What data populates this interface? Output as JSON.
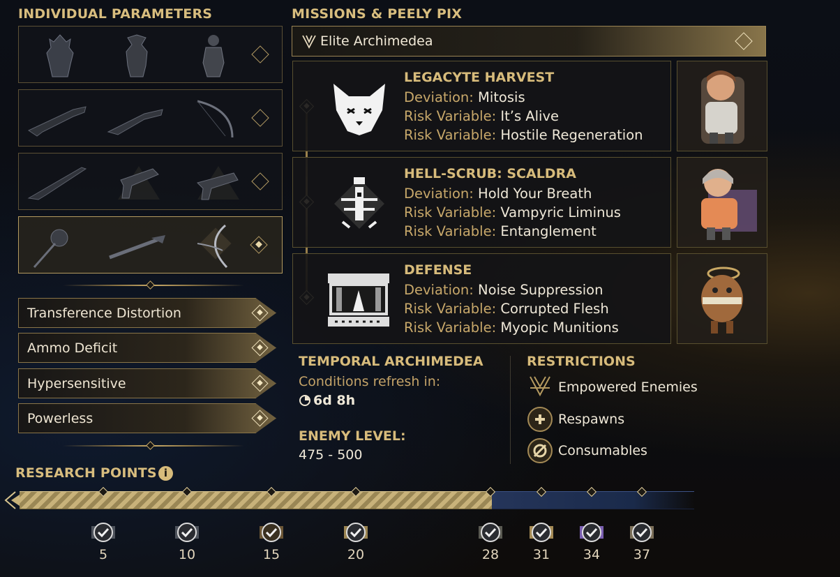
{
  "left": {
    "title": "INDIVIDUAL PARAMETERS",
    "modifiers": [
      "Transference Distortion",
      "Ammo Deficit",
      "Hypersensitive",
      "Powerless"
    ]
  },
  "missions": {
    "title": "MISSIONS & PEELY PIX",
    "header": "Elite Archimedea",
    "cards": [
      {
        "title": "LEGACYTE HARVEST",
        "lines": [
          {
            "key": "Deviation:",
            "value": "Mitosis"
          },
          {
            "key": "Risk Variable:",
            "value": "It’s Alive"
          },
          {
            "key": "Risk Variable:",
            "value": "Hostile Regeneration"
          }
        ]
      },
      {
        "title": "HELL-SCRUB: SCALDRA",
        "lines": [
          {
            "key": "Deviation:",
            "value": "Hold Your Breath"
          },
          {
            "key": "Risk Variable:",
            "value": "Vampyric Liminus"
          },
          {
            "key": "Risk Variable:",
            "value": "Entanglement"
          }
        ]
      },
      {
        "title": "DEFENSE",
        "lines": [
          {
            "key": "Deviation:",
            "value": "Noise Suppression"
          },
          {
            "key": "Risk Variable:",
            "value": "Corrupted Flesh"
          },
          {
            "key": "Risk Variable:",
            "value": "Myopic Munitions"
          }
        ]
      }
    ]
  },
  "temporal": {
    "title": "TEMPORAL ARCHIMEDEA",
    "refresh_label": "Conditions refresh in:",
    "refresh_time": "6d 8h",
    "enemy_level_title": "ENEMY LEVEL:",
    "enemy_level": "475 - 500"
  },
  "restrictions": {
    "title": "RESTRICTIONS",
    "items": [
      "Empowered Enemies",
      "Respawns",
      "Consumables"
    ]
  },
  "research": {
    "title": "RESEARCH POINTS",
    "progress_fraction": 0.71,
    "milestones": [
      "5",
      "10",
      "15",
      "20",
      "28",
      "31",
      "34",
      "37"
    ]
  },
  "colors": {
    "gold": "#d7bb7b",
    "progress_done": "#c8b27a",
    "progress_todo": "#25355a"
  }
}
